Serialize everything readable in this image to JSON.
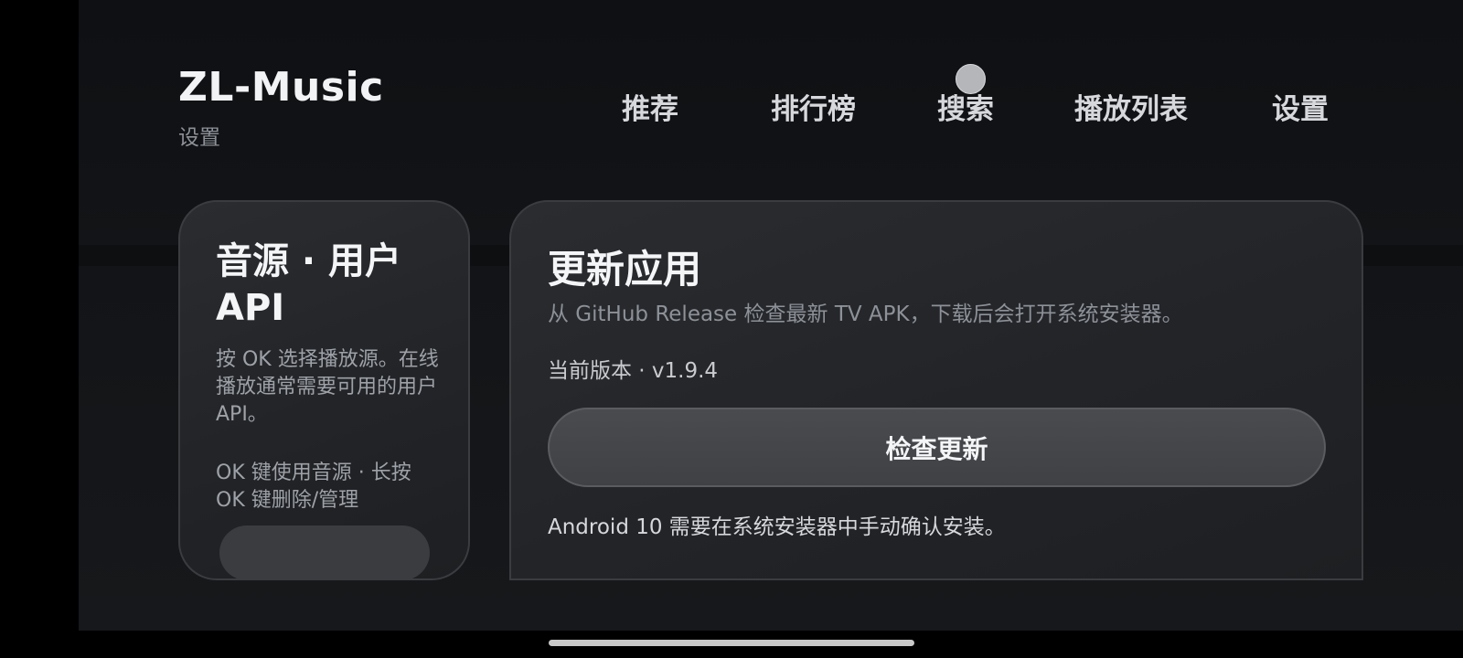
{
  "app": {
    "title": "ZL-Music",
    "page_subtitle": "设置"
  },
  "nav": {
    "tabs": [
      {
        "label": "推荐"
      },
      {
        "label": "排行榜"
      },
      {
        "label": "搜索"
      },
      {
        "label": "播放列表"
      },
      {
        "label": "设置"
      }
    ]
  },
  "source_card": {
    "title": "音源 · 用户 API",
    "description": "按 OK 选择播放源。在线播放通常需要可用的用户 API。",
    "hint": "OK 键使用音源 · 长按 OK 键删除/管理"
  },
  "update_card": {
    "title": "更新应用",
    "description": "从 GitHub Release 检查最新 TV APK，下载后会打开系统安装器。",
    "version_label": "当前版本 · v1.9.4",
    "check_button_label": "检查更新",
    "note": "Android 10 需要在系统安装器中手动确认安装。"
  },
  "colors": {
    "background": "#121417",
    "card": "#25272b",
    "button": "#45474b",
    "text_primary": "#f4f5f7",
    "text_secondary": "#8d9198"
  }
}
